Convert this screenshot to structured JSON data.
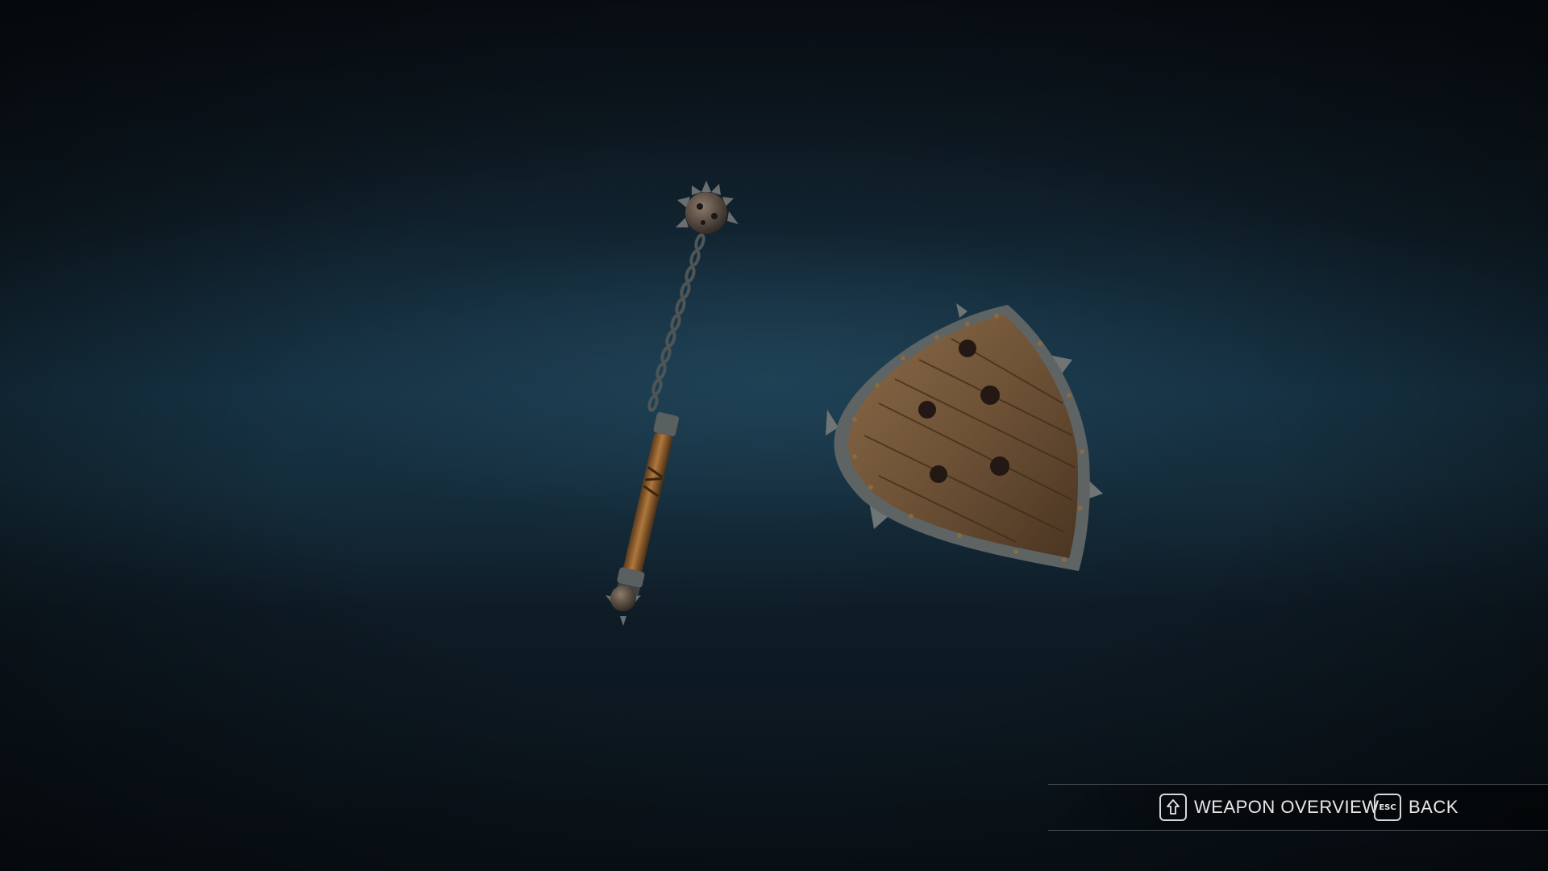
{
  "scene": {
    "background_color": "#0b141b",
    "items": [
      {
        "name": "flail",
        "icon": "flail-weapon"
      },
      {
        "name": "shield",
        "icon": "kite-shield"
      }
    ]
  },
  "controls": {
    "weapon_overview": {
      "key_icon": "shift-arrow-icon",
      "label": "WEAPON OVERVIEW"
    },
    "back": {
      "key_label": "ESC",
      "label": "BACK"
    }
  },
  "colors": {
    "text": "#e8e8e8",
    "key_border": "#d8d8d8",
    "wood": "#7a5a3a",
    "metal": "#5a5f60"
  }
}
